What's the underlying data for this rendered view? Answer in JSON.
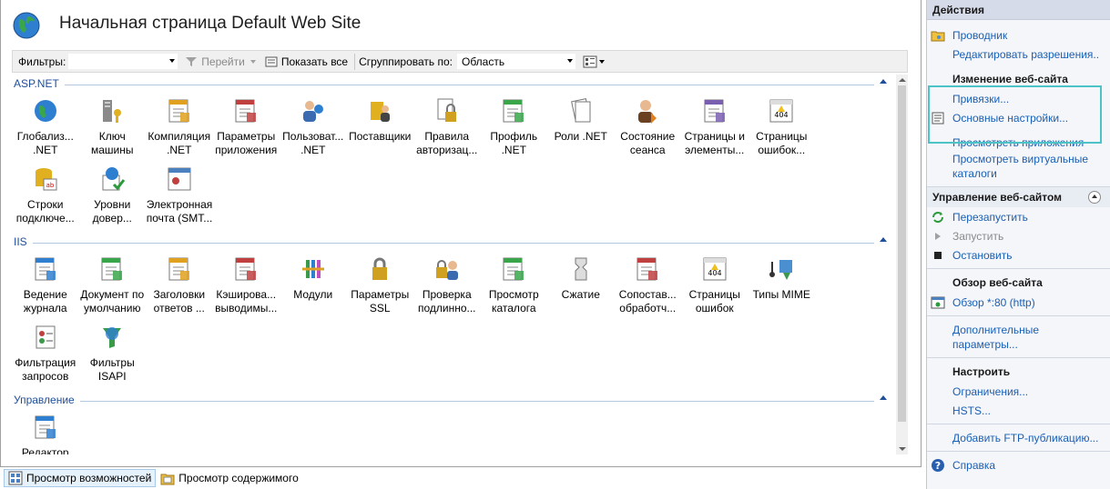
{
  "header": {
    "title": "Начальная страница Default Web Site"
  },
  "filterbar": {
    "filter_label": "Фильтры:",
    "filter_value": "",
    "go_label": "Перейти",
    "show_all_label": "Показать все",
    "group_label": "Сгруппировать по:",
    "group_value": "Область"
  },
  "groups": [
    {
      "name": "ASP.NET",
      "items": [
        {
          "line1": "Глобализ...",
          "line2": ".NET",
          "icon": "globe-icon"
        },
        {
          "line1": "Ключ",
          "line2": "машины",
          "icon": "machine-key-icon"
        },
        {
          "line1": "Компиляция",
          "line2": ".NET",
          "icon": "compilation-icon"
        },
        {
          "line1": "Параметры",
          "line2": "приложения",
          "icon": "app-settings-icon"
        },
        {
          "line1": "Пользоват...",
          "line2": ".NET",
          "icon": "users-icon"
        },
        {
          "line1": "Поставщики",
          "line2": "",
          "icon": "providers-icon"
        },
        {
          "line1": "Правила",
          "line2": "авторизац...",
          "icon": "auth-rules-icon"
        },
        {
          "line1": "Профиль",
          "line2": ".NET",
          "icon": "profile-icon"
        },
        {
          "line1": "Роли .NET",
          "line2": "",
          "icon": "roles-icon"
        },
        {
          "line1": "Состояние",
          "line2": "сеанса",
          "icon": "session-icon"
        },
        {
          "line1": "Страницы и",
          "line2": "элементы...",
          "icon": "pages-controls-icon"
        },
        {
          "line1": "Страницы",
          "line2": "ошибок...",
          "icon": "error-pages-icon"
        },
        {
          "line1": "Строки",
          "line2": "подключе...",
          "icon": "connection-strings-icon"
        },
        {
          "line1": "Уровни",
          "line2": "довер...",
          "icon": "trust-levels-icon"
        },
        {
          "line1": "Электронная",
          "line2": "почта (SMT...",
          "icon": "smtp-icon"
        }
      ]
    },
    {
      "name": "IIS",
      "items": [
        {
          "line1": "Ведение",
          "line2": "журнала",
          "icon": "logging-icon"
        },
        {
          "line1": "Документ по",
          "line2": "умолчанию",
          "icon": "default-document-icon"
        },
        {
          "line1": "Заголовки",
          "line2": "ответов ...",
          "icon": "response-headers-icon"
        },
        {
          "line1": "Кэширова...",
          "line2": "выводимы...",
          "icon": "output-caching-icon"
        },
        {
          "line1": "Модули",
          "line2": "",
          "icon": "modules-icon"
        },
        {
          "line1": "Параметры",
          "line2": "SSL",
          "icon": "ssl-icon"
        },
        {
          "line1": "Проверка",
          "line2": "подлинно...",
          "icon": "authentication-icon"
        },
        {
          "line1": "Просмотр",
          "line2": "каталога",
          "icon": "directory-browsing-icon"
        },
        {
          "line1": "Сжатие",
          "line2": "",
          "icon": "compression-icon"
        },
        {
          "line1": "Сопостав...",
          "line2": "обработч...",
          "icon": "handler-mappings-icon"
        },
        {
          "line1": "Страницы",
          "line2": "ошибок",
          "icon": "iis-error-pages-icon"
        },
        {
          "line1": "Типы MIME",
          "line2": "",
          "icon": "mime-types-icon"
        },
        {
          "line1": "Фильтрация",
          "line2": "запросов",
          "icon": "request-filtering-icon"
        },
        {
          "line1": "Фильтры",
          "line2": "ISAPI",
          "icon": "isapi-filters-icon"
        }
      ]
    },
    {
      "name": "Управление",
      "items": [
        {
          "line1": "Редактор",
          "line2": "",
          "icon": "config-editor-icon"
        }
      ]
    }
  ],
  "bottombar": {
    "features_view": "Просмотр возможностей",
    "content_view": "Просмотр содержимого"
  },
  "actions": {
    "title": "Действия",
    "explore": "Проводник",
    "edit_permissions": "Редактировать разрешения...",
    "edit_site_header": "Изменение веб-сайта",
    "bindings": "Привязки...",
    "basic_settings": "Основные настройки...",
    "view_apps": "Просмотреть приложения",
    "view_vdirs": "Просмотреть виртуальные",
    "view_vdirs2": "каталоги",
    "manage_header": "Управление веб-сайтом",
    "restart": "Перезапустить",
    "start": "Запустить",
    "stop": "Остановить",
    "browse_header": "Обзор веб-сайта",
    "browse_80": "Обзор *:80 (http)",
    "advanced": "Дополнительные",
    "advanced2": "параметры...",
    "configure_header": "Настроить",
    "limits": "Ограничения...",
    "hsts": "HSTS...",
    "add_ftp": "Добавить FTP-публикацию...",
    "help": "Справка"
  }
}
